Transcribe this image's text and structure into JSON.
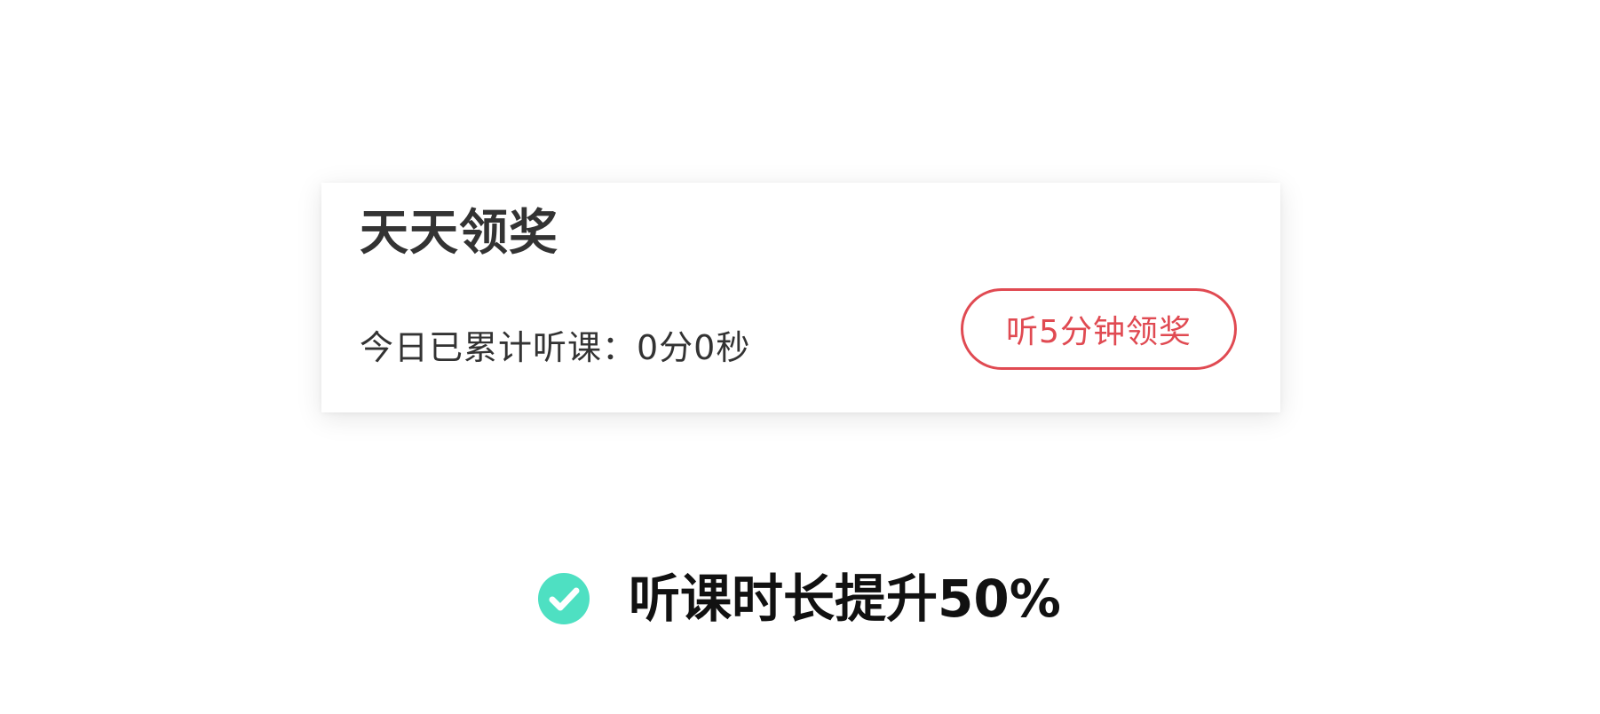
{
  "card": {
    "title": "天天领奖",
    "stat_text": "今日已累计听课：0分0秒",
    "claim_button_label": "听5分钟领奖"
  },
  "benefit": {
    "icon": "check-circle-icon",
    "text": "听课时长提升50%"
  },
  "colors": {
    "accent_red": "#e04a52",
    "check_green": "#4ee0c2",
    "text_dark": "#333333"
  }
}
